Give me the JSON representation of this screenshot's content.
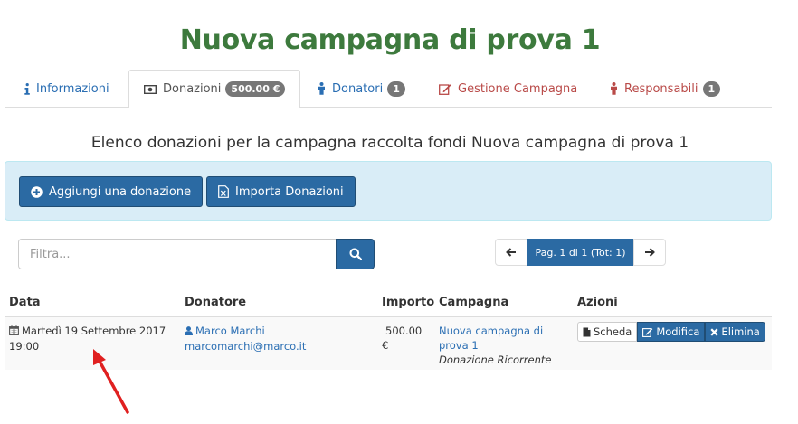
{
  "page": {
    "title": "Nuova campagna di prova 1"
  },
  "tabs": [
    {
      "label": "Informazioni",
      "icon": "info-icon",
      "badge": ""
    },
    {
      "label": "Donazioni",
      "icon": "money-icon",
      "badge": "500.00 €"
    },
    {
      "label": "Donatori",
      "icon": "person-icon",
      "badge": "1"
    },
    {
      "label": "Gestione Campagna",
      "icon": "edit-icon",
      "badge": ""
    },
    {
      "label": "Responsabili",
      "icon": "person-icon",
      "badge": "1"
    }
  ],
  "subtitle": "Elenco donazioni per la campagna raccolta fondi Nuova campagna di prova 1",
  "toolbar": {
    "add_label": "Aggiungi una donazione",
    "import_label": "Importa Donazioni"
  },
  "filter": {
    "placeholder": "Filtra...",
    "value": ""
  },
  "pagination": {
    "label": "Pag. 1 di 1 (Tot: 1)"
  },
  "table": {
    "headers": [
      "Data",
      "Donatore",
      "Importo",
      "Campagna",
      "Azioni"
    ],
    "rows": [
      {
        "date": "Martedì 19 Settembre 2017",
        "time": "19:00",
        "donor_name": "Marco Marchi",
        "donor_email": "marcomarchi@marco.it",
        "amount": "500.00",
        "currency": "€",
        "campaign": "Nuova campagna di prova 1",
        "type": "Donazione Ricorrente",
        "actions": [
          "Scheda",
          "Modifica",
          "Elimina"
        ]
      }
    ]
  },
  "colors": {
    "title": "#3d7a3d",
    "primary": "#2b6aa3",
    "link": "#2a6eb3",
    "danger": "#b94a48",
    "panel": "#d9edf7",
    "annotation": "#e02020"
  }
}
